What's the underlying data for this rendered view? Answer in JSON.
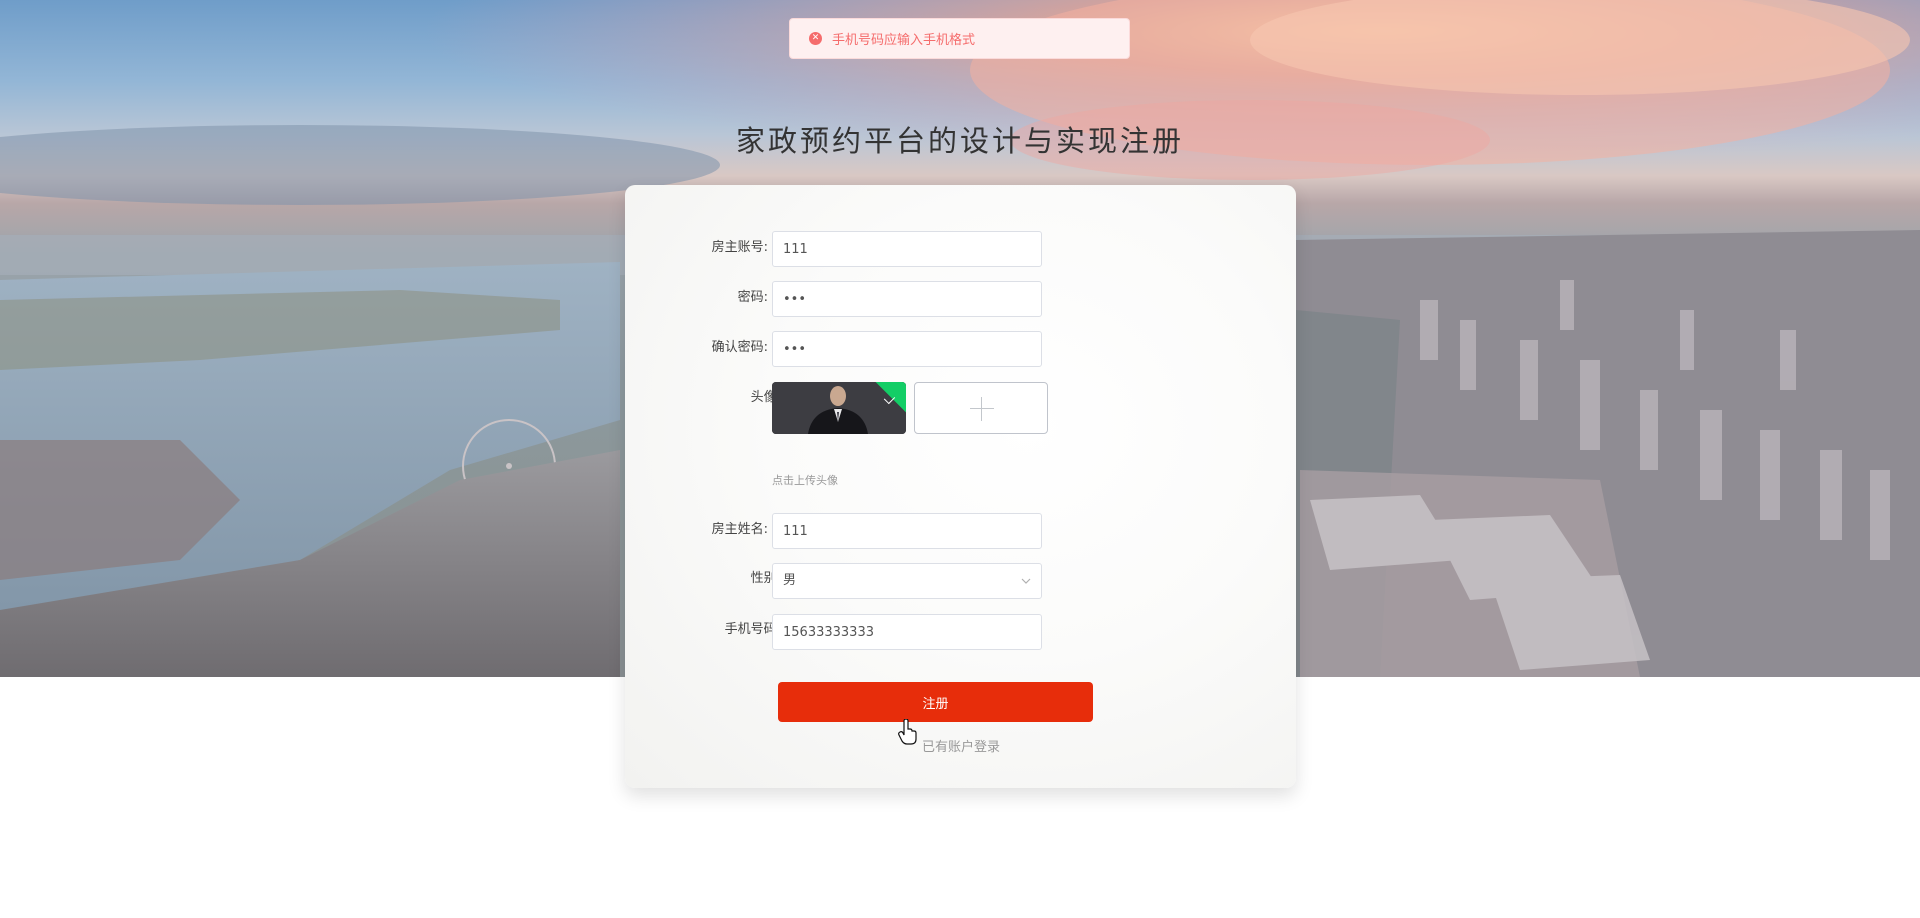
{
  "toast": {
    "icon": "error-circle-icon",
    "message": "手机号码应输入手机格式"
  },
  "page_title": "家政预约平台的设计与实现注册",
  "form": {
    "account": {
      "label": "房主账号:",
      "required_mark": "*",
      "value": "111"
    },
    "password": {
      "label": "密码:",
      "required_mark": "*",
      "value": "•••"
    },
    "confirm_password": {
      "label": "确认密码:",
      "required_mark": "*",
      "value": "•••"
    },
    "avatar": {
      "label": "头像:",
      "hint": "点击上传头像"
    },
    "owner_name": {
      "label": "房主姓名:",
      "required_mark": "*",
      "value": "111"
    },
    "gender": {
      "label": "性别:",
      "value": "男"
    },
    "phone": {
      "label": "手机号码:",
      "value": "15633333333"
    }
  },
  "buttons": {
    "register": "注册",
    "login_link": "已有账户登录"
  },
  "colors": {
    "accent": "#e72d0b",
    "error": "#f56c6c",
    "success_badge": "#13ce66"
  }
}
